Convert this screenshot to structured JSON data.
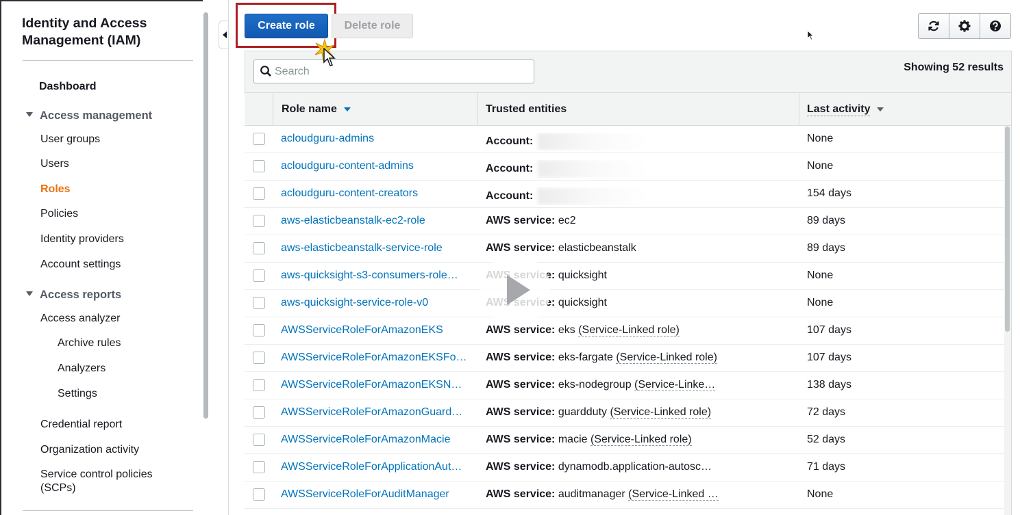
{
  "sidebar": {
    "title": "Identity and Access Management (IAM)",
    "dashboard": "Dashboard",
    "access_management": {
      "label": "Access management",
      "items": [
        "User groups",
        "Users",
        "Roles",
        "Policies",
        "Identity providers",
        "Account settings"
      ],
      "active": "Roles"
    },
    "access_reports": {
      "label": "Access reports",
      "analyzer": "Access analyzer",
      "analyzer_items": [
        "Archive rules",
        "Analyzers",
        "Settings"
      ],
      "items": [
        "Credential report",
        "Organization activity",
        "Service control policies (SCPs)"
      ]
    }
  },
  "toolbar": {
    "create_label": "Create role",
    "delete_label": "Delete role",
    "icons": [
      "refresh-icon",
      "gear-icon",
      "help-icon"
    ]
  },
  "search": {
    "placeholder": "Search"
  },
  "results": "Showing 52 results",
  "table": {
    "columns": [
      "Role name",
      "Trusted entities",
      "Last activity"
    ],
    "rows": [
      {
        "name": "acloudguru-admins",
        "trust_label": "Account:",
        "trust_value": "",
        "last": "None"
      },
      {
        "name": "acloudguru-content-admins",
        "trust_label": "Account:",
        "trust_value": "",
        "last": "None"
      },
      {
        "name": "acloudguru-content-creators",
        "trust_label": "Account:",
        "trust_value": "",
        "last": "154 days"
      },
      {
        "name": "aws-elasticbeanstalk-ec2-role",
        "trust_label": "AWS service:",
        "trust_value": "ec2",
        "last": "89 days"
      },
      {
        "name": "aws-elasticbeanstalk-service-role",
        "trust_label": "AWS service:",
        "trust_value": "elasticbeanstalk",
        "last": "89 days"
      },
      {
        "name": "aws-quicksight-s3-consumers-role…",
        "trust_label": "AWS service:",
        "trust_value": "quicksight",
        "last": "None"
      },
      {
        "name": "aws-quicksight-service-role-v0",
        "trust_label": "AWS service:",
        "trust_value": "quicksight",
        "last": "None"
      },
      {
        "name": "AWSServiceRoleForAmazonEKS",
        "trust_label": "AWS service:",
        "trust_value": "eks",
        "trust_suffix": "(Service-Linked role)",
        "last": "107 days"
      },
      {
        "name": "AWSServiceRoleForAmazonEKSFo…",
        "trust_label": "AWS service:",
        "trust_value": "eks-fargate",
        "trust_suffix": "(Service-Linked role)",
        "last": "107 days"
      },
      {
        "name": "AWSServiceRoleForAmazonEKSN…",
        "trust_label": "AWS service:",
        "trust_value": "eks-nodegroup",
        "trust_suffix": "(Service-Linke…",
        "last": "138 days"
      },
      {
        "name": "AWSServiceRoleForAmazonGuard…",
        "trust_label": "AWS service:",
        "trust_value": "guardduty",
        "trust_suffix": "(Service-Linked role)",
        "last": "72 days"
      },
      {
        "name": "AWSServiceRoleForAmazonMacie",
        "trust_label": "AWS service:",
        "trust_value": "macie",
        "trust_suffix": "(Service-Linked role)",
        "last": "52 days"
      },
      {
        "name": "AWSServiceRoleForApplicationAut…",
        "trust_label": "AWS service:",
        "trust_value": "dynamodb.application-autosc…",
        "last": "71 days"
      },
      {
        "name": "AWSServiceRoleForAuditManager",
        "trust_label": "AWS service:",
        "trust_value": "auditmanager",
        "trust_suffix": "(Service-Linked …",
        "last": "None"
      }
    ]
  },
  "colors": {
    "primary_button": "#1e6fc9",
    "link": "#0073bb",
    "active_nav": "#ec7211",
    "highlight_box": "#b01e23"
  }
}
